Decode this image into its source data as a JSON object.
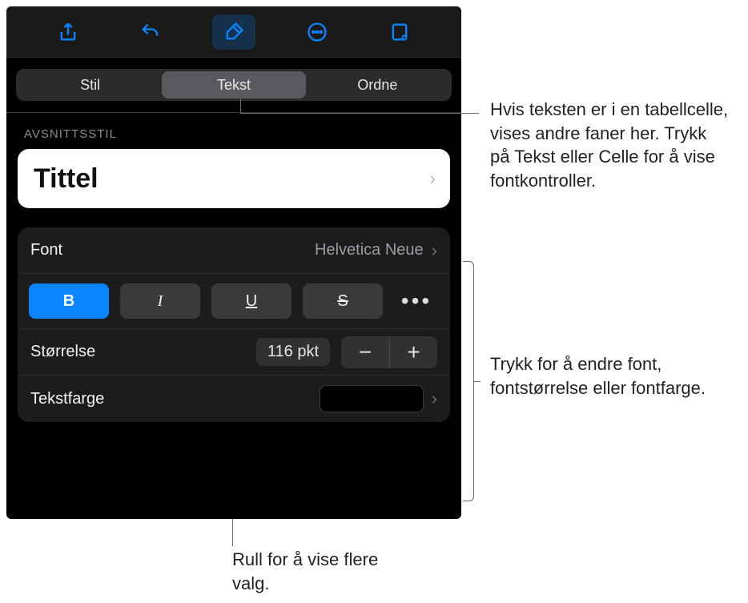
{
  "tabs": {
    "stil": "Stil",
    "tekst": "Tekst",
    "ordne": "Ordne"
  },
  "section_label": "AVSNITTSSTIL",
  "style_name": "Tittel",
  "font_row": {
    "label": "Font",
    "value": "Helvetica Neue"
  },
  "format_buttons": {
    "bold": "B",
    "italic": "I",
    "underline": "U",
    "strike": "S",
    "more": "•••"
  },
  "size_row": {
    "label": "Størrelse",
    "value": "116 pkt",
    "minus": "−",
    "plus": "+"
  },
  "color_row": {
    "label": "Tekstfarge"
  },
  "annotations": {
    "tabs_note": "Hvis teksten er i en tabellcelle, vises andre faner her. Trykk på Tekst eller Celle for å vise fontkontroller.",
    "font_note": "Trykk for å endre font, fontstørrelse eller fontfarge.",
    "scroll_note": "Rull for å vise flere valg."
  }
}
